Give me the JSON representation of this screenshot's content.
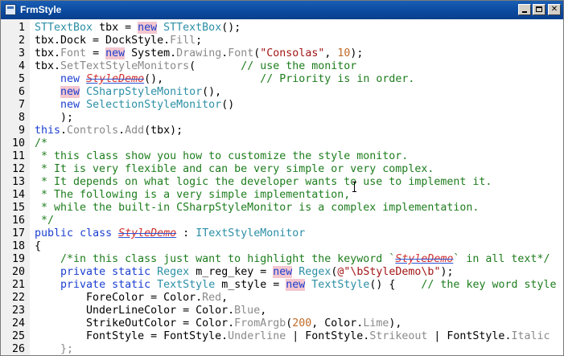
{
  "window": {
    "title": "FrmStyle"
  },
  "colors": {
    "keyword": "#1a3fd0",
    "type": "#2b8fa6",
    "comment": "#1e7d1e",
    "string": "#a31515",
    "number": "#c06a28",
    "member": "#8a8a8a",
    "highlight": "#f4c6cf"
  },
  "icons": {
    "app": "form-icon",
    "minimize": "minimize-icon",
    "maximize": "maximize-icon",
    "close": "close-icon"
  },
  "editor": {
    "lines": [
      {
        "n": "1",
        "segs": [
          [
            "STTextBox",
            "t"
          ],
          [
            " tbx = ",
            ""
          ],
          [
            "new",
            "kh"
          ],
          [
            " STTextBox",
            "t"
          ],
          [
            "();",
            ""
          ]
        ]
      },
      {
        "n": "2",
        "segs": [
          [
            "tbx.Dock = DockStyle.",
            ""
          ],
          [
            "Fill",
            "m"
          ],
          [
            ";",
            ""
          ]
        ]
      },
      {
        "n": "3",
        "segs": [
          [
            "tbx.",
            ""
          ],
          [
            "Font",
            "m"
          ],
          [
            " = ",
            ""
          ],
          [
            "new",
            "kh"
          ],
          [
            " System.",
            ""
          ],
          [
            "Drawing",
            "m"
          ],
          [
            ".",
            ""
          ],
          [
            "Font",
            "m"
          ],
          [
            "(",
            ""
          ],
          [
            "\"Consolas\"",
            "s"
          ],
          [
            ", ",
            ""
          ],
          [
            "10",
            "n"
          ],
          [
            ");",
            ""
          ]
        ]
      },
      {
        "n": "4",
        "segs": [
          [
            "tbx.",
            ""
          ],
          [
            "SetTextStyleMonitors",
            "m"
          ],
          [
            "(       ",
            ""
          ],
          [
            "// use the monitor",
            "c"
          ]
        ]
      },
      {
        "n": "5",
        "segs": [
          [
            "    ",
            ""
          ],
          [
            "new",
            "k"
          ],
          [
            " ",
            ""
          ],
          [
            "StyleDemo",
            "sd"
          ],
          [
            "(),               ",
            ""
          ],
          [
            "// Priority is in order.",
            "c"
          ]
        ]
      },
      {
        "n": "6",
        "segs": [
          [
            "    ",
            ""
          ],
          [
            "new",
            "kh"
          ],
          [
            " CSharpStyleMonitor",
            "t"
          ],
          [
            "(),",
            ""
          ]
        ]
      },
      {
        "n": "7",
        "segs": [
          [
            "    ",
            ""
          ],
          [
            "new",
            "k"
          ],
          [
            " SelectionStyleMonitor",
            "t"
          ],
          [
            "()",
            ""
          ]
        ]
      },
      {
        "n": "8",
        "segs": [
          [
            "    );",
            ""
          ]
        ]
      },
      {
        "n": "9",
        "segs": [
          [
            "this",
            "k"
          ],
          [
            ".",
            ""
          ],
          [
            "Controls",
            "m"
          ],
          [
            ".",
            ""
          ],
          [
            "Add",
            "m"
          ],
          [
            "(tbx);",
            ""
          ]
        ]
      },
      {
        "n": "10",
        "segs": [
          [
            "/*",
            "c"
          ]
        ]
      },
      {
        "n": "11",
        "segs": [
          [
            " * this class show you how to customize the style monitor.",
            "c"
          ]
        ]
      },
      {
        "n": "12",
        "segs": [
          [
            " * It is very flexible and can be very simple or very complex.",
            "c"
          ]
        ]
      },
      {
        "n": "13",
        "segs": [
          [
            " * It depends on what logic the developer wants to use to implement it.",
            "c"
          ]
        ]
      },
      {
        "n": "14",
        "segs": [
          [
            " * The following is a very simple implementation,",
            "c"
          ]
        ]
      },
      {
        "n": "15",
        "segs": [
          [
            " * while the built-in CSharpStyleMonitor is a complex implementation.",
            "c"
          ]
        ]
      },
      {
        "n": "16",
        "segs": [
          [
            " */",
            "c"
          ]
        ]
      },
      {
        "n": "17",
        "segs": [
          [
            "public",
            "k"
          ],
          [
            " ",
            ""
          ],
          [
            "class",
            "k"
          ],
          [
            " ",
            ""
          ],
          [
            "StyleDemo",
            "sd"
          ],
          [
            " : ",
            ""
          ],
          [
            "ITextStyleMonitor",
            "t"
          ]
        ]
      },
      {
        "n": "18",
        "segs": [
          [
            "{",
            ""
          ]
        ]
      },
      {
        "n": "19",
        "segs": [
          [
            "    ",
            ""
          ],
          [
            "/*in this class just want to highlight the keyword `",
            "c"
          ],
          [
            "StyleDemo",
            "sdc"
          ],
          [
            "` in all text*/",
            "c"
          ]
        ]
      },
      {
        "n": "20",
        "segs": [
          [
            "    ",
            ""
          ],
          [
            "private",
            "k"
          ],
          [
            " ",
            ""
          ],
          [
            "static",
            "k"
          ],
          [
            " Regex",
            "t"
          ],
          [
            " m_reg_key = ",
            ""
          ],
          [
            "new",
            "kh"
          ],
          [
            " Regex",
            "t"
          ],
          [
            "(",
            ""
          ],
          [
            "@\"\\bStyleDemo\\b\"",
            "s"
          ],
          [
            ");",
            ""
          ]
        ]
      },
      {
        "n": "21",
        "segs": [
          [
            "    ",
            ""
          ],
          [
            "private",
            "k"
          ],
          [
            " ",
            ""
          ],
          [
            "static",
            "k"
          ],
          [
            " TextStyle",
            "t"
          ],
          [
            " m_style = ",
            ""
          ],
          [
            "new",
            "kh"
          ],
          [
            " TextStyle",
            "t"
          ],
          [
            "() {    ",
            ""
          ],
          [
            "// the key word style",
            "c"
          ]
        ]
      },
      {
        "n": "22",
        "segs": [
          [
            "        ForeColor = Color.",
            ""
          ],
          [
            "Red",
            "m"
          ],
          [
            ",",
            ""
          ]
        ]
      },
      {
        "n": "23",
        "segs": [
          [
            "        UnderLineColor = Color.",
            ""
          ],
          [
            "Blue",
            "m"
          ],
          [
            ",",
            ""
          ]
        ]
      },
      {
        "n": "24",
        "segs": [
          [
            "        StrikeOutColor = Color.",
            ""
          ],
          [
            "FromArgb",
            "m"
          ],
          [
            "(",
            ""
          ],
          [
            "200",
            "n"
          ],
          [
            ", Color.",
            ""
          ],
          [
            "Lime",
            "m"
          ],
          [
            "),",
            ""
          ]
        ]
      },
      {
        "n": "25",
        "segs": [
          [
            "        FontStyle = FontStyle.",
            ""
          ],
          [
            "Underline",
            "m"
          ],
          [
            " | FontStyle.",
            ""
          ],
          [
            "Strikeout",
            "m"
          ],
          [
            " | FontStyle.",
            ""
          ],
          [
            "Italic",
            "m"
          ]
        ]
      },
      {
        "n": "26",
        "segs": [
          [
            "    };",
            "m"
          ]
        ]
      }
    ]
  }
}
